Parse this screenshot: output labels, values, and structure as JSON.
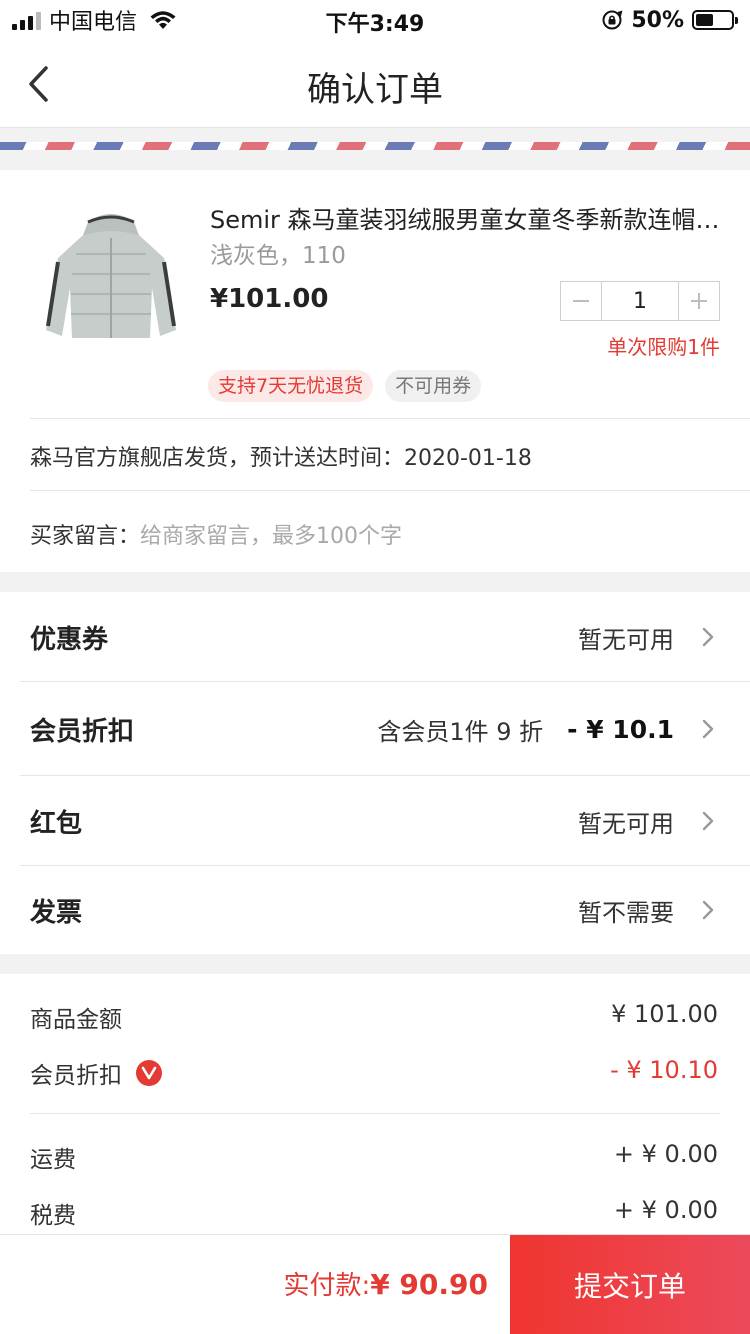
{
  "status_bar": {
    "carrier": "中国电信",
    "time": "下午3:49",
    "battery_percent": "50%",
    "battery_level": 0.5,
    "icons": [
      "signal-icon",
      "wifi-icon",
      "rotation-lock-icon",
      "battery-icon"
    ]
  },
  "nav": {
    "title": "确认订单"
  },
  "product": {
    "title": "Semir 森马童装羽绒服男童女童冬季新款连帽外套",
    "variant": "浅灰色，110",
    "price": "¥101.00",
    "quantity": "1",
    "limit_text": "单次限购1件",
    "tags": [
      "支持7天无忧退货",
      "不可用券"
    ]
  },
  "shipping": {
    "text": "森马官方旗舰店发货，预计送达时间：2020-01-18"
  },
  "buyer_message": {
    "label": "买家留言：",
    "placeholder": "给商家留言，最多100个字"
  },
  "options": [
    {
      "label": "优惠券",
      "value": "暂无可用",
      "amount": ""
    },
    {
      "label": "会员折扣",
      "value": "含会员1件 9 折",
      "amount": "- ¥ 10.1"
    },
    {
      "label": "红包",
      "value": "暂无可用",
      "amount": ""
    },
    {
      "label": "发票",
      "value": "暂不需要",
      "amount": ""
    }
  ],
  "summary": [
    {
      "label": "商品金额",
      "value": "¥ 101.00"
    },
    {
      "label": "会员折扣",
      "value": "- ¥ 10.10"
    },
    {
      "label": "运费",
      "value": "+ ¥ 0.00"
    },
    {
      "label": "税费",
      "value": "+ ¥ 0.00"
    }
  ],
  "bottom": {
    "total_label": "实付款:",
    "total_amount": "¥ 90.90",
    "submit_label": "提交订单"
  },
  "colors": {
    "accent_red": "#e33a33",
    "button_gradient_start": "#ef3530",
    "button_gradient_end": "#ec4a5b"
  }
}
